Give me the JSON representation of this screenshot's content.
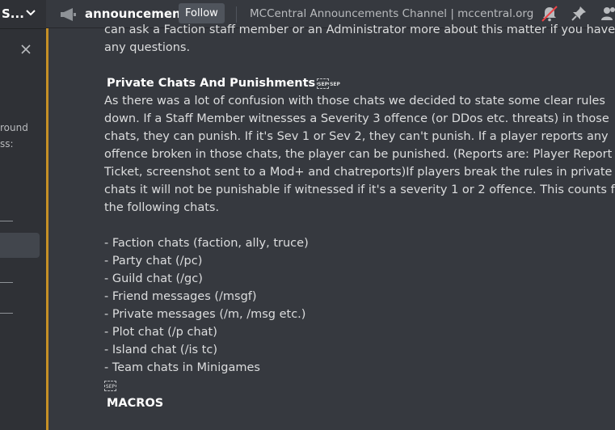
{
  "server": {
    "name": "S..."
  },
  "sidebar": {
    "fragment_1": "round",
    "fragment_2": "ss:"
  },
  "header": {
    "channel": "announcements",
    "follow_label": "Follow",
    "topic": "MCCentral Announcements Channel | mccentral.org"
  },
  "message": {
    "lead_lines": [
      "can ask a Faction staff member or an Administrator more about this matter if you have",
      "any questions."
    ],
    "section_title": "Private Chats And Punishments",
    "sep_glyph": "SEP SEP",
    "paragraph_lines": [
      "As there was a lot of confusion with those chats we decided to state some clear rules",
      "down. If a Staff Member witnesses a Severity 3 offence (or DDos etc. threats) in those",
      "chats, they can punish. If it's Sev 1 or Sev 2, they can't punish. If a player reports any",
      "offence broken in those chats, the player can be punished. (Reports are: Player Report",
      "Ticket, screenshot sent to a Mod+ and chatreports)If players break the rules in private",
      "chats it will not be punishable if witnessed if it's a severity 1 or 2 offence. This counts for",
      "the following chats."
    ],
    "chat_list": [
      "- Faction chats (faction, ally, truce)",
      "- Party chat (/pc)",
      "- Guild chat (/gc)",
      "- Friend messages (/msgf)",
      "- Private messages (/m, /msg etc.)",
      "- Plot chat (/p chat)",
      "- Island chat (/is tc)",
      "- Team chats in Minigames"
    ],
    "sep_glyph_2": "SEP",
    "next_title": "MACROS"
  },
  "colors": {
    "background": "#36393f",
    "sidebar": "#2f3136",
    "accent_bar": "#c69026",
    "text": "#dcddde"
  }
}
